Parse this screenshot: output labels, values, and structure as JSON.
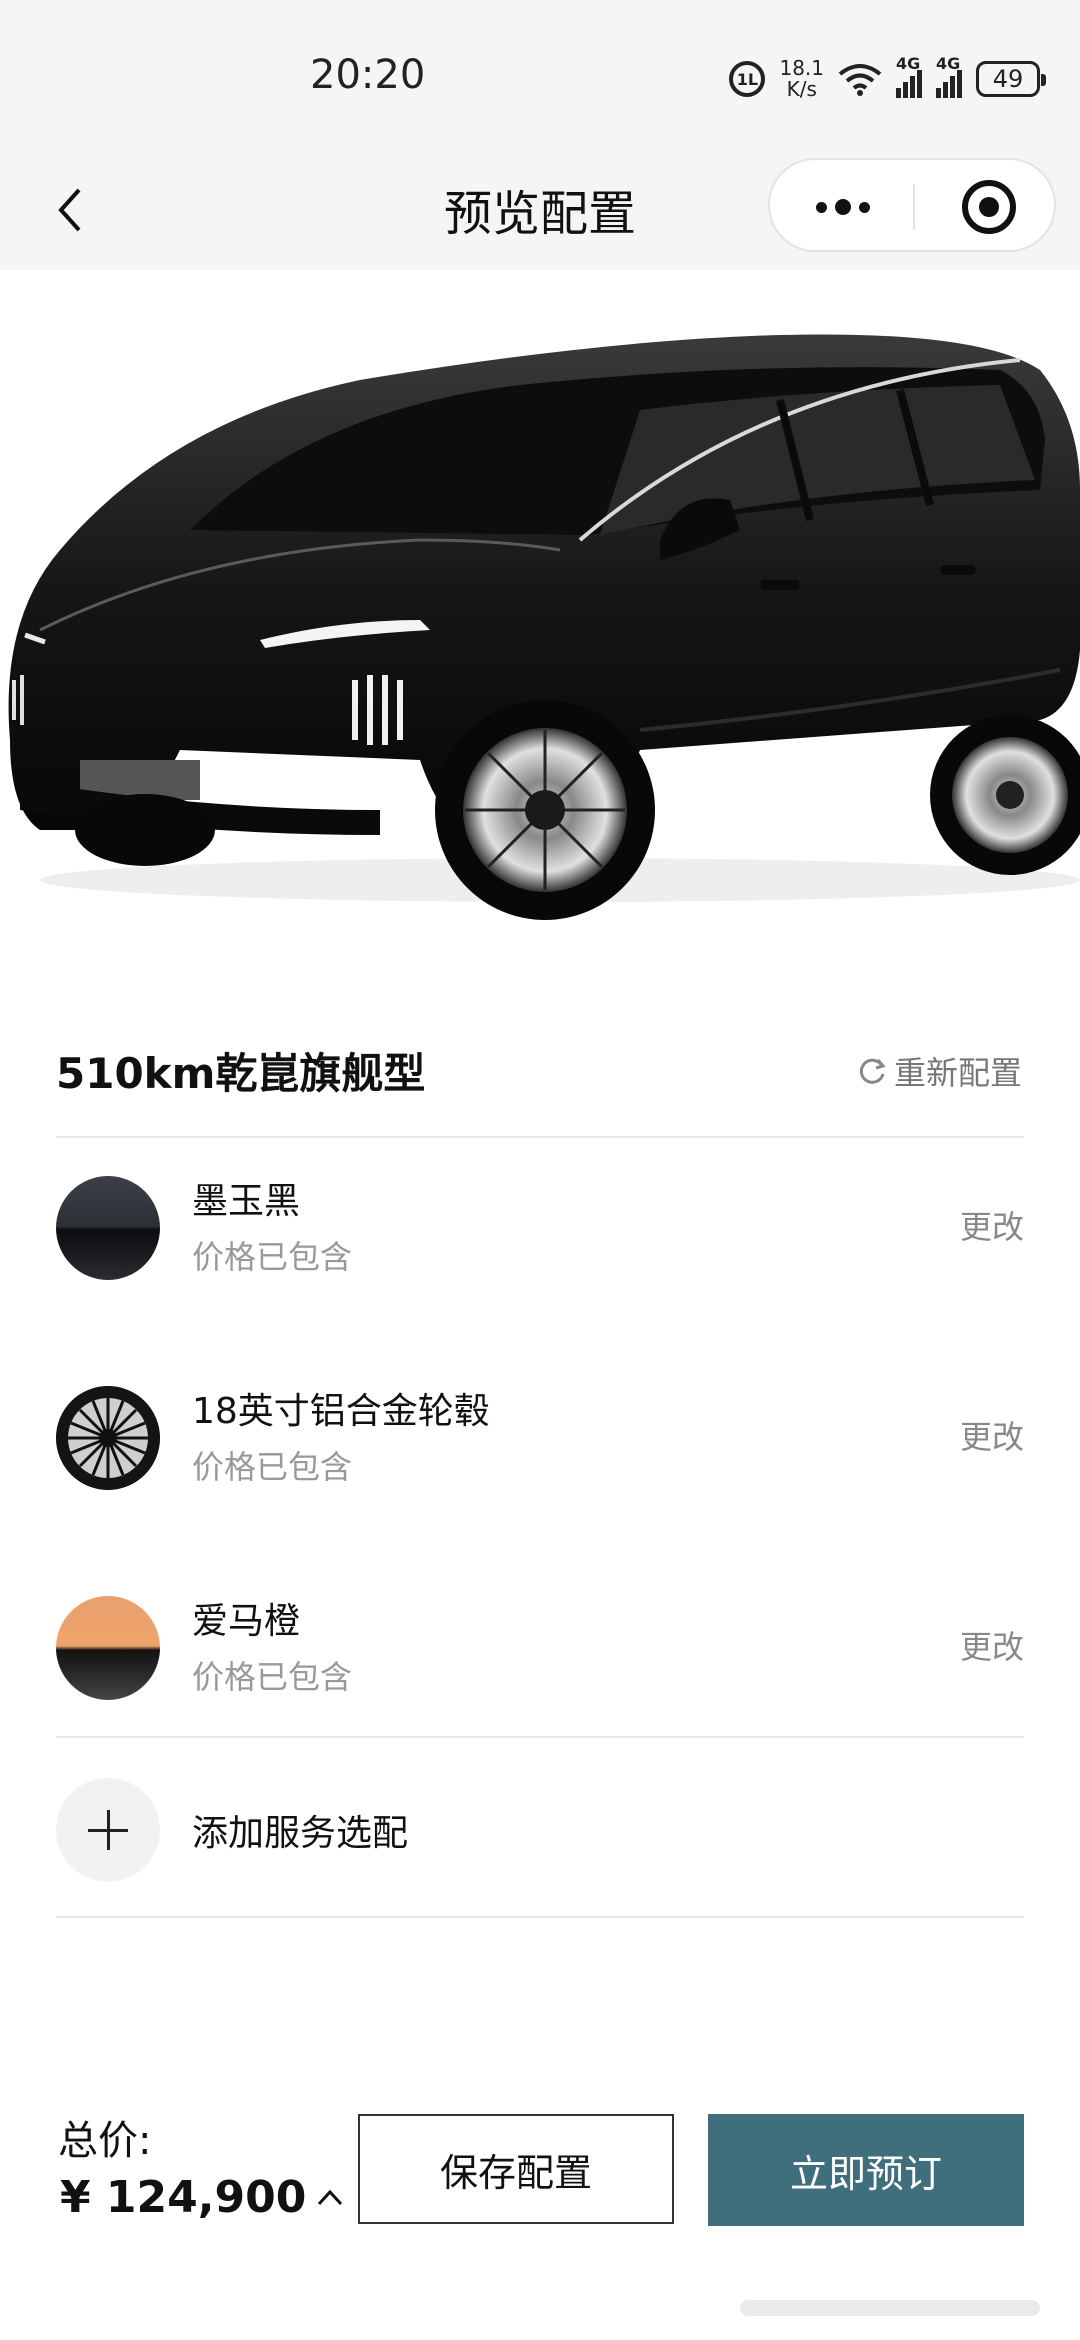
{
  "status_bar": {
    "time": "20:20",
    "hd": "1L",
    "speed_value": "18.1",
    "speed_unit": "K/s",
    "signal1": "4G",
    "signal2": "4G",
    "battery": "49"
  },
  "nav": {
    "title": "预览配置"
  },
  "config": {
    "model": "510km乾崑旗舰型",
    "reconfigure": "重新配置",
    "options": [
      {
        "name": "墨玉黑",
        "note": "价格已包含",
        "action": "更改",
        "swatch": "black"
      },
      {
        "name": "18英寸铝合金轮毂",
        "note": "价格已包含",
        "action": "更改",
        "swatch": "wheel"
      },
      {
        "name": "爱马橙",
        "note": "价格已包含",
        "action": "更改",
        "swatch": "orange"
      }
    ],
    "add_service": "添加服务选配"
  },
  "footer": {
    "total_label": "总价:",
    "total_price": "¥ 124,900",
    "save": "保存配置",
    "order": "立即预订"
  },
  "colors": {
    "accent": "#3f6e7c",
    "body_black": "#111111",
    "orange": "#f0a46d"
  }
}
